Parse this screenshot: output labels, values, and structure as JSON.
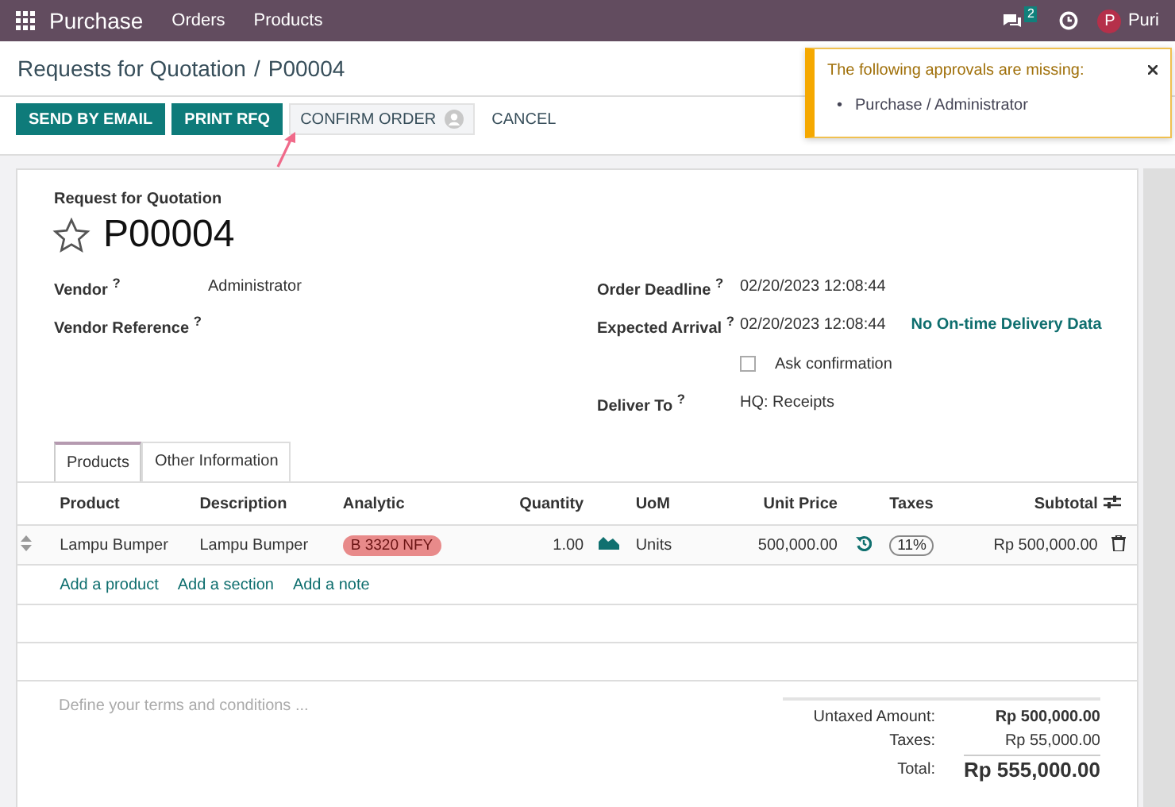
{
  "navbar": {
    "app_name": "Purchase",
    "menu": [
      "Orders",
      "Products"
    ],
    "chat_count": "2",
    "user": {
      "initial": "P",
      "name": "Puri"
    }
  },
  "breadcrumb": {
    "parent": "Requests for Quotation",
    "separator": "/",
    "current": "P00004"
  },
  "buttons": [
    {
      "label": "SEND BY EMAIL",
      "kind": "primary"
    },
    {
      "label": "PRINT RFQ",
      "kind": "primary"
    },
    {
      "label": "CONFIRM ORDER",
      "kind": "approval"
    },
    {
      "label": "CANCEL",
      "kind": "link"
    }
  ],
  "notification": {
    "title": "The following approvals are missing:",
    "bullet": "•",
    "items": [
      "Purchase / Administrator"
    ]
  },
  "form": {
    "subtitle": "Request for Quotation",
    "title": "P00004",
    "starred": false,
    "left_fields": [
      {
        "label": "Vendor $^{?}$",
        "value": "Administrator"
      },
      {
        "label": "Vendor Reference $^{?}$"
      }
    ],
    "right_fields": [
      {
        "kind": "text",
        "label": "Order Deadline $^{?}$",
        "value": "02/20/2023 12:08:44"
      },
      {
        "kind": "text",
        "label": "Expected Arrival $^{?}$",
        "value": "02/20/2023 12:08:44",
        "note": "No On-time Delivery Data"
      },
      {
        "kind": "checkbox",
        "label": "Ask confirmation",
        "checked": false
      },
      {
        "kind": "text",
        "label": "Deliver To $^{?}$",
        "value": "HQ: Receipts"
      }
    ]
  },
  "tabs": [
    {
      "label": "Products",
      "selected": true
    },
    {
      "label": "Other Information",
      "selected": false
    }
  ],
  "table": {
    "columns": [
      "Product",
      "Description",
      "Analytic",
      "Quantity",
      "UoM",
      "Unit Price",
      "Taxes",
      "Subtotal"
    ],
    "rows": [
      {
        "product": "Lampu Bumper",
        "description": "Lampu Bumper",
        "analytic": {
          "label": "B 3320 NFY",
          "color": "#e88a8a"
        },
        "quantity": "1.00",
        "uom": "Units",
        "unit_price": "500,000.00",
        "taxes": "11%",
        "subtotal": "Rp 500,000.00"
      }
    ],
    "add_links": [
      "Add a product",
      "Add a section",
      "Add a note"
    ]
  },
  "terms": {
    "placeholder": "Define your terms and conditions ..."
  },
  "totals": [
    {
      "kind": "strong",
      "label": "Untaxed Amount:",
      "value": "Rp 500,000.00"
    },
    {
      "kind": "normal",
      "label": "Taxes:",
      "value": "Rp 55,000.00"
    },
    {
      "kind": "grand",
      "label": "Total:",
      "value": "Rp 555,000.00"
    }
  ]
}
